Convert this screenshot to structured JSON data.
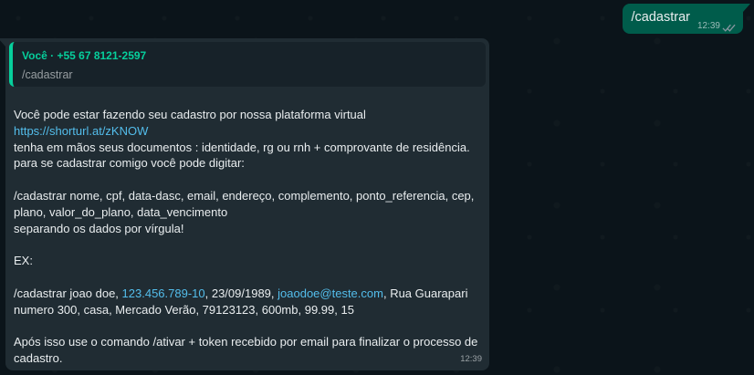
{
  "outgoing": {
    "text": "/cadastrar",
    "time": "12:39",
    "status_icon": "double-check-read-icon"
  },
  "incoming": {
    "quote": {
      "author": "Você · +55 67 8121-2597",
      "text": "/cadastrar"
    },
    "lines": {
      "l1": "Você pode estar fazendo seu cadastro por nossa plataforma virtual",
      "l2_link": "https://shorturl.at/zKNOW",
      "l3": "tenha em mãos seus documentos : identidade, rg ou rnh + comprovante de residência.",
      "l4": "para se cadastrar comigo você pode digitar:",
      "l5": "/cadastrar nome, cpf, data-dasc, email, endereço, complemento, ponto_referencia, cep,",
      "l6": "plano, valor_do_plano, data_vencimento",
      "l7": "separando os dados por vírgula!",
      "l8": "EX:",
      "ex_a": "/cadastrar joao doe, ",
      "ex_phone": "123.456.789-10",
      "ex_b": ", 23/09/1989, ",
      "ex_email": "joaodoe@teste.com",
      "ex_c": ", Rua Guarapari",
      "ex_line2": "numero 300, casa, Mercado Verão, 79123123, 600mb, 99.99, 15",
      "final1": "Após isso use o comando /ativar + token recebido por email para finalizar o processo de",
      "final2": "cadastro."
    },
    "time": "12:39"
  },
  "colors": {
    "background": "#0b141a",
    "outgoing_bubble": "#005c4b",
    "incoming_bubble": "#202c33",
    "quote_accent": "#06cf9c",
    "link": "#53bdeb",
    "read_ticks": "#53bdeb"
  }
}
